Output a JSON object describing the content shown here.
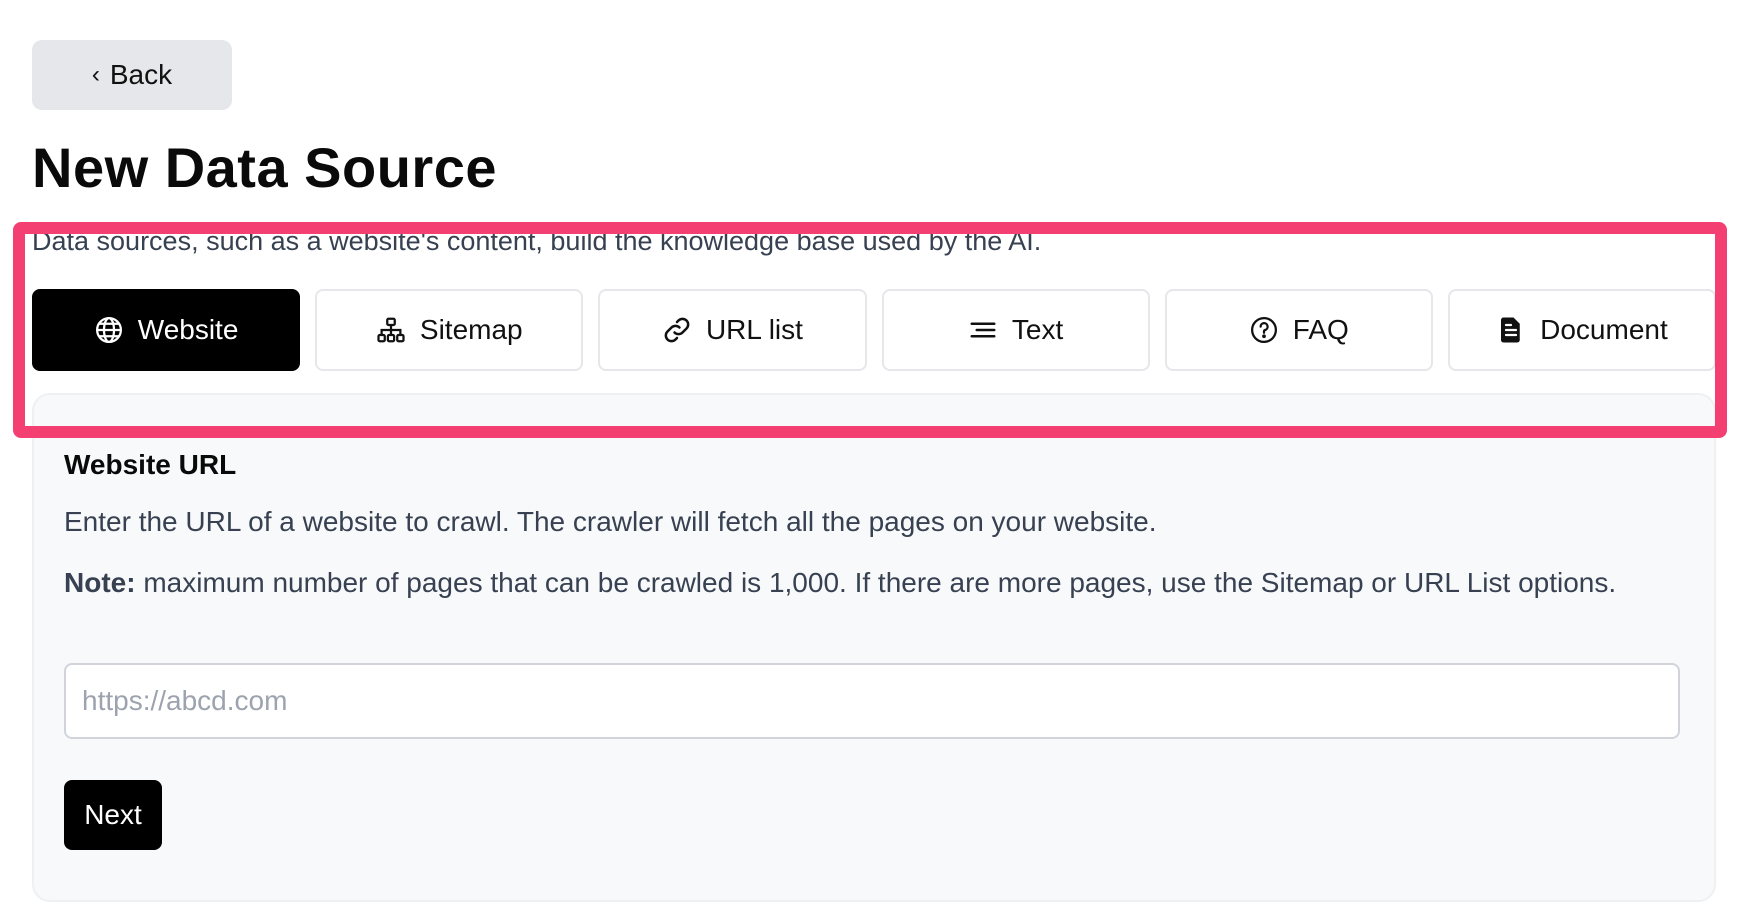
{
  "back_button": {
    "label": "Back"
  },
  "page": {
    "title": "New Data Source",
    "subtitle": "Data sources, such as a website's content, build the knowledge base used by the AI."
  },
  "tabs": [
    {
      "label": "Website",
      "icon": "globe-icon",
      "active": true
    },
    {
      "label": "Sitemap",
      "icon": "sitemap-icon",
      "active": false
    },
    {
      "label": "URL list",
      "icon": "link-icon",
      "active": false
    },
    {
      "label": "Text",
      "icon": "lines-icon",
      "active": false
    },
    {
      "label": "FAQ",
      "icon": "question-circle-icon",
      "active": false
    },
    {
      "label": "Document",
      "icon": "document-icon",
      "active": false
    }
  ],
  "panel": {
    "title": "Website URL",
    "description": "Enter the URL of a website to crawl. The crawler will fetch all the pages on your website.",
    "note_label": "Note:",
    "note_text": " maximum number of pages that can be crawled is 1,000. If there are more pages, use the Sitemap or URL List options.",
    "input_placeholder": "https://abcd.com",
    "input_value": "",
    "next_label": "Next"
  },
  "colors": {
    "highlight": "#f43f73",
    "active_tab": "#000000",
    "panel_bg": "#f8f9fa"
  }
}
